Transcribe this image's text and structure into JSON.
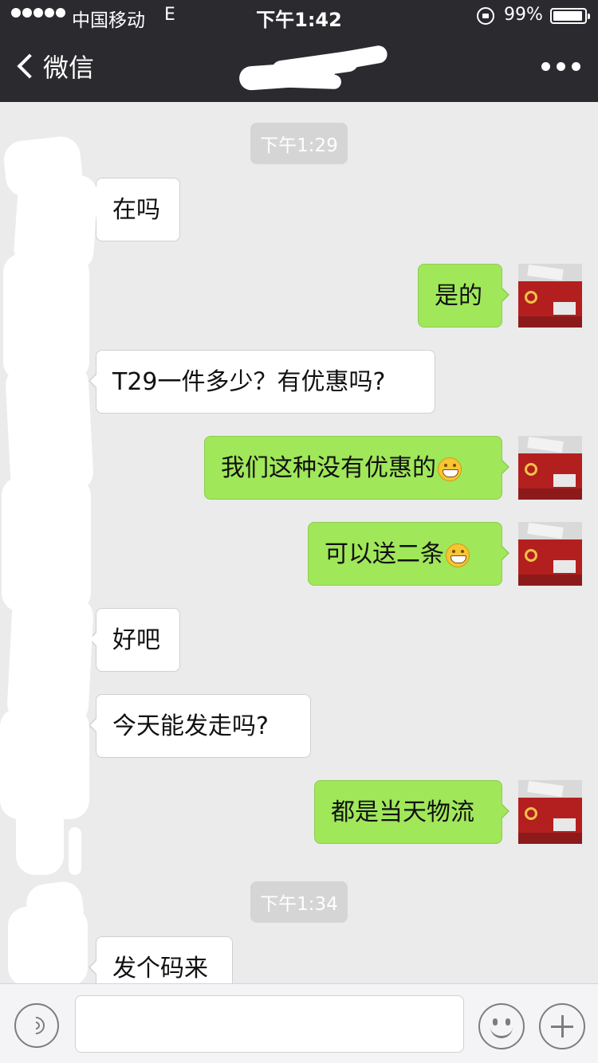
{
  "status_bar": {
    "carrier": "中国移动",
    "network": "E",
    "time": "下午1:42",
    "battery": "99%"
  },
  "nav": {
    "back_label": "微信",
    "contact_name_redacted": true
  },
  "messages": [
    {
      "type": "timestamp",
      "text": "下午1:29"
    },
    {
      "type": "incoming",
      "text": "在吗"
    },
    {
      "type": "outgoing",
      "text": "是的"
    },
    {
      "type": "incoming",
      "text": "T29一件多少？有优惠吗?"
    },
    {
      "type": "outgoing",
      "text": "我们这种没有优惠的",
      "emoji": "grin-emoji"
    },
    {
      "type": "outgoing",
      "text": "可以送二条",
      "emoji": "grin-emoji"
    },
    {
      "type": "incoming",
      "text": "好吧"
    },
    {
      "type": "incoming",
      "text": "今天能发走吗?"
    },
    {
      "type": "outgoing",
      "text": "都是当天物流"
    },
    {
      "type": "timestamp",
      "text": "下午1:34"
    },
    {
      "type": "incoming",
      "text": "发个码来"
    }
  ],
  "input_bar": {
    "voice_icon": "voice-icon",
    "text_value": "",
    "emoji_icon": "emoji-face-icon",
    "plus_icon": "plus-icon"
  },
  "colors": {
    "nav_background": "#2b2b2f",
    "chat_background": "#ebebeb",
    "outgoing_bubble": "#a0e75a",
    "incoming_bubble": "#ffffff",
    "timestamp_pill": "#d5d5d5"
  }
}
